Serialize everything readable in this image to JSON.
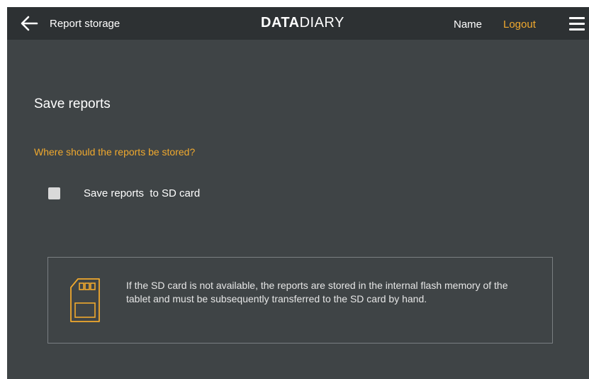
{
  "header": {
    "title": "Report storage",
    "logo_bold": "DATA",
    "logo_light": "DIARY",
    "user_name": "Name",
    "logout_label": "Logout"
  },
  "main": {
    "section_title": "Save reports",
    "question": "Where should the reports be stored?",
    "option": {
      "label": "Save reports  to SD card",
      "checked": false
    },
    "info": {
      "icon": "sd-card-icon",
      "text": "If the SD card is not available, the reports are stored in the internal flash memory of the tablet and must be subsequently transferred to the SD card by hand."
    }
  },
  "colors": {
    "background": "#3f4446",
    "header": "#2d3133",
    "accent": "#f0a92e",
    "text": "#ffffff"
  }
}
